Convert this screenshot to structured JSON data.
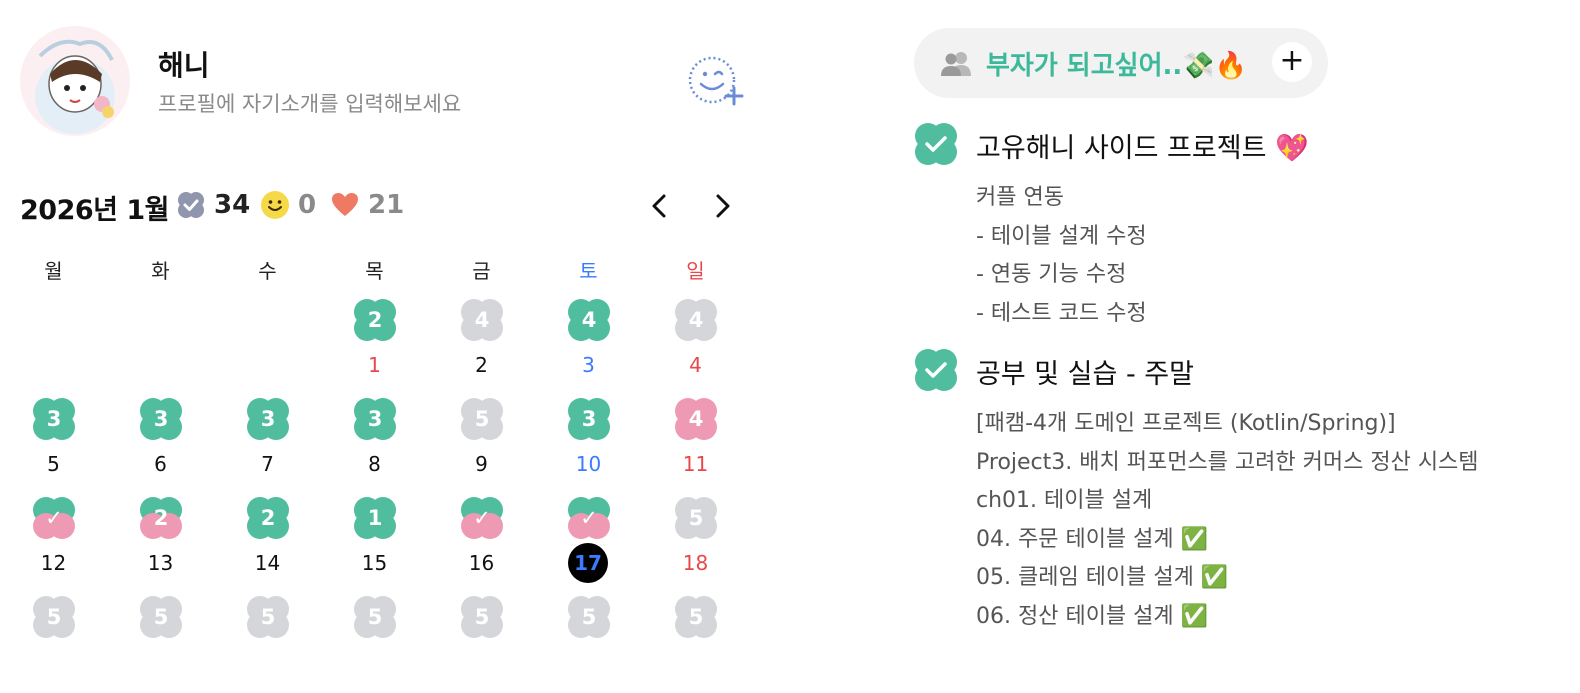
{
  "profile": {
    "name": "해니",
    "bio": "프로필에 자기소개를 입력해보세요"
  },
  "calendar": {
    "month_title": "2026년 1월",
    "stats": {
      "done": "34",
      "smile": "0",
      "heart": "21"
    },
    "weekdays": [
      "월",
      "화",
      "수",
      "목",
      "금",
      "토",
      "일"
    ],
    "weekday_colors": [
      "#222222",
      "#222222",
      "#222222",
      "#222222",
      "#222222",
      "#3a7bff",
      "#e8484a"
    ],
    "days": [
      {
        "day": "1",
        "col": 3,
        "row": 0,
        "badge": "2",
        "style": "green",
        "day_color": "#e8484a"
      },
      {
        "day": "2",
        "col": 4,
        "row": 0,
        "badge": "4",
        "style": "gray",
        "day_color": "#111111"
      },
      {
        "day": "3",
        "col": 5,
        "row": 0,
        "badge": "4",
        "style": "green",
        "day_color": "#3a7bff"
      },
      {
        "day": "4",
        "col": 6,
        "row": 0,
        "badge": "4",
        "style": "gray",
        "day_color": "#e8484a"
      },
      {
        "day": "5",
        "col": 0,
        "row": 1,
        "badge": "3",
        "style": "green",
        "day_color": "#111111"
      },
      {
        "day": "6",
        "col": 1,
        "row": 1,
        "badge": "3",
        "style": "green",
        "day_color": "#111111"
      },
      {
        "day": "7",
        "col": 2,
        "row": 1,
        "badge": "3",
        "style": "green",
        "day_color": "#111111"
      },
      {
        "day": "8",
        "col": 3,
        "row": 1,
        "badge": "3",
        "style": "green",
        "day_color": "#111111"
      },
      {
        "day": "9",
        "col": 4,
        "row": 1,
        "badge": "5",
        "style": "gray",
        "day_color": "#111111"
      },
      {
        "day": "10",
        "col": 5,
        "row": 1,
        "badge": "3",
        "style": "green",
        "day_color": "#3a7bff"
      },
      {
        "day": "11",
        "col": 6,
        "row": 1,
        "badge": "4",
        "style": "pink",
        "day_color": "#e8484a"
      },
      {
        "day": "12",
        "col": 0,
        "row": 2,
        "badge": "✓",
        "style": "split",
        "day_color": "#111111"
      },
      {
        "day": "13",
        "col": 1,
        "row": 2,
        "badge": "2",
        "style": "split",
        "day_color": "#111111"
      },
      {
        "day": "14",
        "col": 2,
        "row": 2,
        "badge": "2",
        "style": "green",
        "day_color": "#111111"
      },
      {
        "day": "15",
        "col": 3,
        "row": 2,
        "badge": "1",
        "style": "green",
        "day_color": "#111111"
      },
      {
        "day": "16",
        "col": 4,
        "row": 2,
        "badge": "✓",
        "style": "split",
        "day_color": "#111111"
      },
      {
        "day": "17",
        "col": 5,
        "row": 2,
        "badge": "✓",
        "style": "split",
        "day_color": "#3a7bff",
        "today": true
      },
      {
        "day": "18",
        "col": 6,
        "row": 2,
        "badge": "5",
        "style": "gray",
        "day_color": "#e8484a"
      },
      {
        "day": "",
        "col": 0,
        "row": 3,
        "badge": "5",
        "style": "gray",
        "day_color": "#111111"
      },
      {
        "day": "",
        "col": 1,
        "row": 3,
        "badge": "5",
        "style": "gray",
        "day_color": "#111111"
      },
      {
        "day": "",
        "col": 2,
        "row": 3,
        "badge": "5",
        "style": "gray",
        "day_color": "#111111"
      },
      {
        "day": "",
        "col": 3,
        "row": 3,
        "badge": "5",
        "style": "gray",
        "day_color": "#111111"
      },
      {
        "day": "",
        "col": 4,
        "row": 3,
        "badge": "5",
        "style": "gray",
        "day_color": "#111111"
      },
      {
        "day": "",
        "col": 5,
        "row": 3,
        "badge": "5",
        "style": "gray",
        "day_color": "#3a7bff"
      },
      {
        "day": "",
        "col": 6,
        "row": 3,
        "badge": "5",
        "style": "gray",
        "day_color": "#e8484a"
      }
    ]
  },
  "goal": {
    "title": "부자가 되고싶어..💸🔥"
  },
  "todos": [
    {
      "title": "고유해니 사이드 프로젝트 💖",
      "lines": [
        "커플 연동",
        "- 테이블 설계 수정",
        "- 연동 기능 수정",
        "- 테스트 코드 수정"
      ]
    },
    {
      "title": "공부 및 실습 - 주말",
      "lines": [
        "[패캠-4개 도메인 프로젝트 (Kotlin/Spring)]",
        "Project3. 배치 퍼포먼스를 고려한 커머스 정산 시스템",
        "ch01. 테이블 설계",
        "04. 주문 테이블 설계 ✅",
        "05. 클레임 테이블 설계 ✅",
        "06. 정산 테이블 설계 ✅"
      ]
    }
  ],
  "colors": {
    "green": "#4fbd9e",
    "gray": "#d4d6da",
    "pink": "#ef9ab4",
    "accent": "#3bb99a"
  },
  "icons": {
    "avatar": "avatar-illustration",
    "add_friend": "add-friend-smile-icon",
    "done_stat": "clover-check-icon",
    "smile_stat": "smile-icon",
    "heart_stat": "heart-icon",
    "prev": "chevron-left-icon",
    "next": "chevron-right-icon",
    "people": "people-icon",
    "plus": "plus-icon",
    "check": "check-clover-icon"
  }
}
